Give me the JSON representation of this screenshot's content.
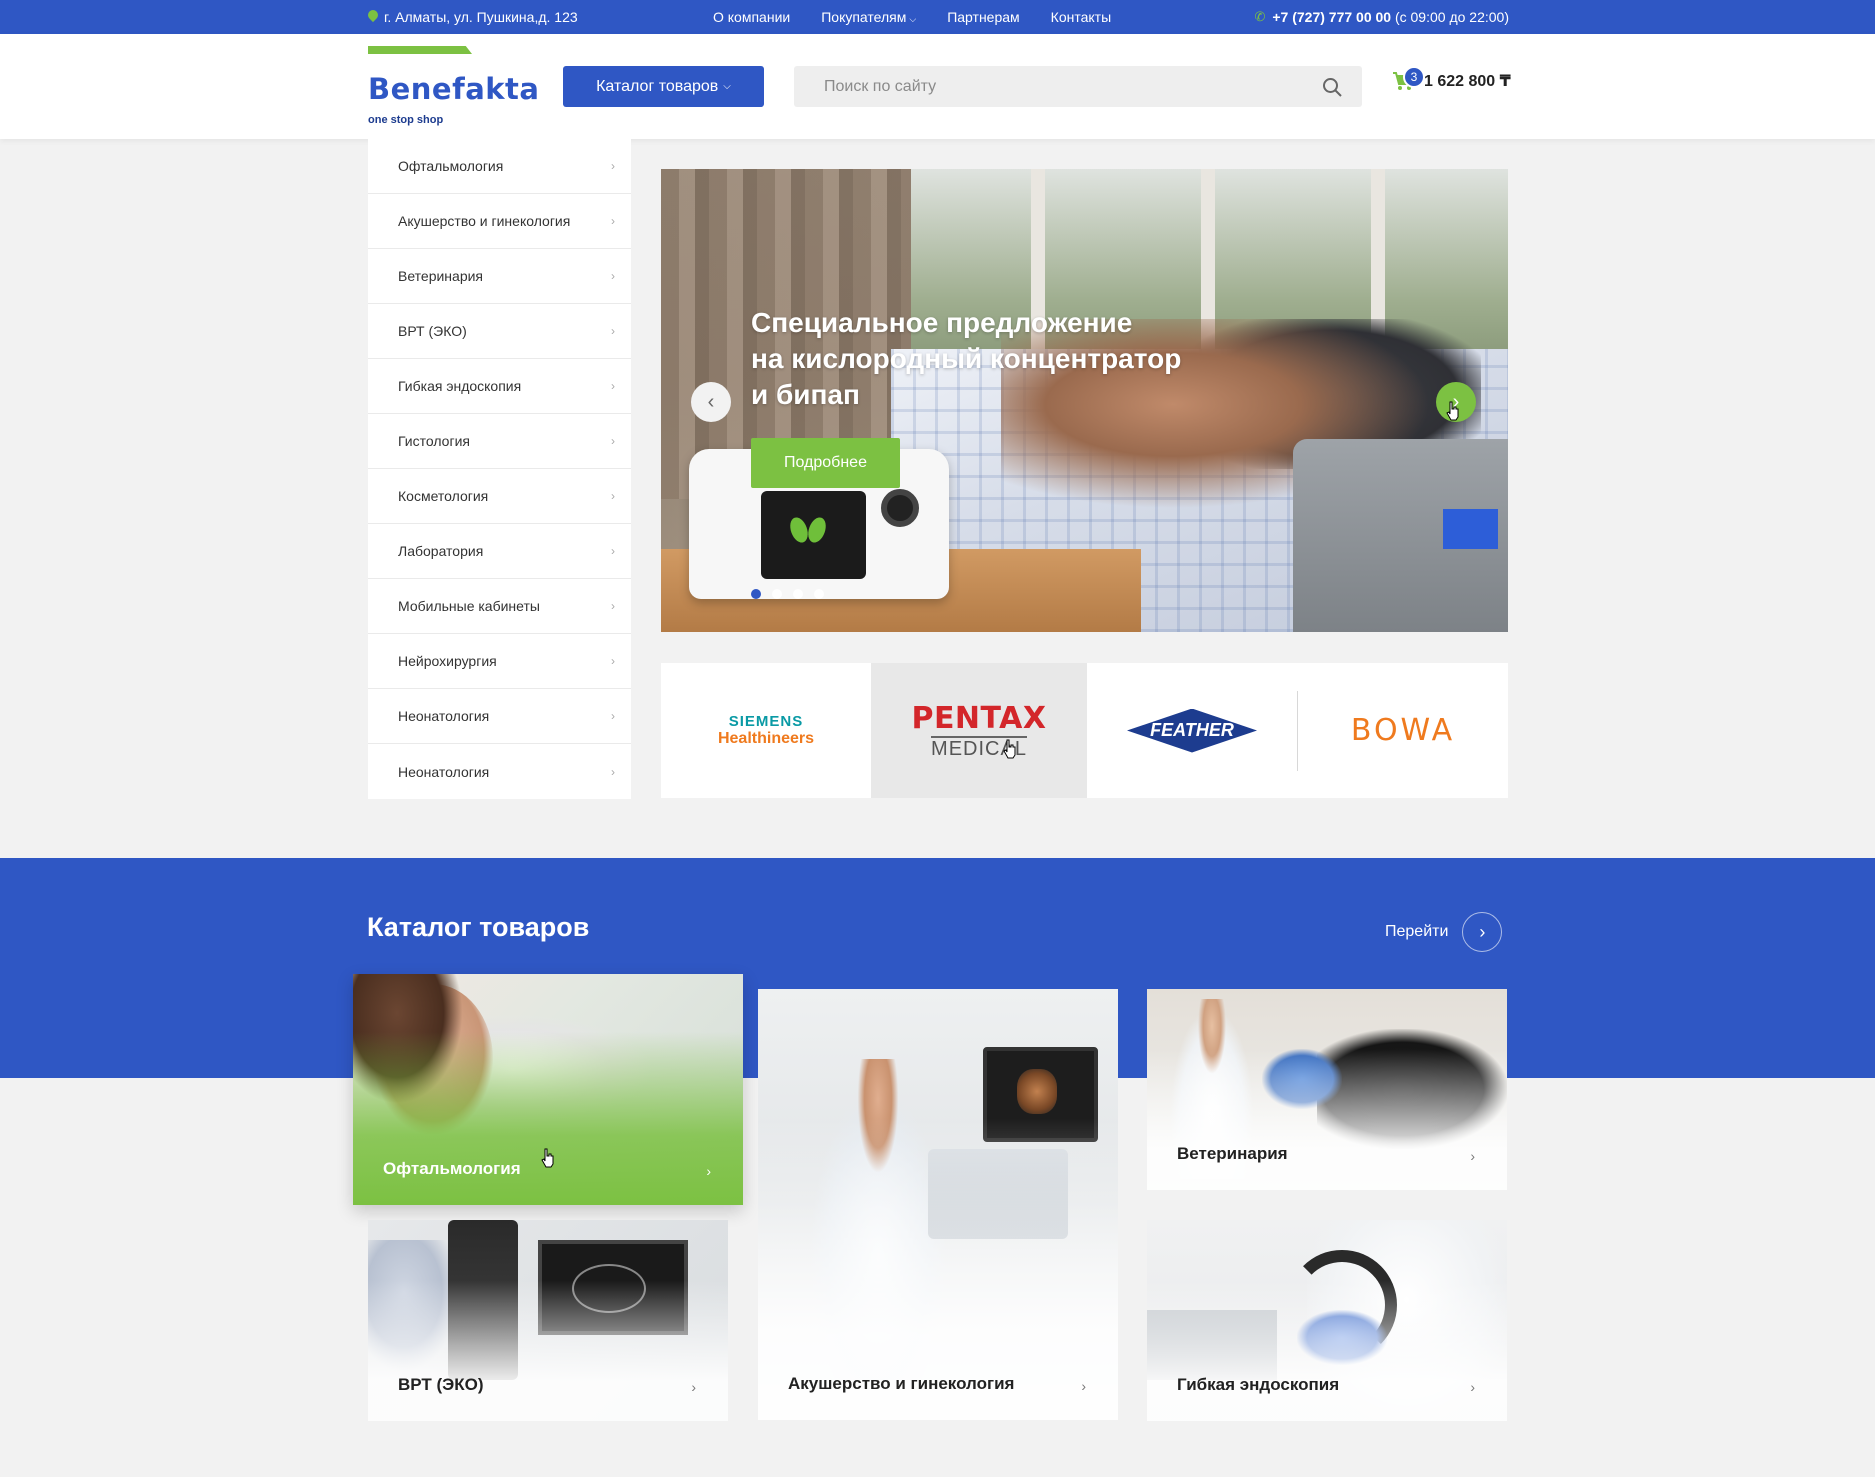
{
  "topbar": {
    "address": "г. Алматы, ул. Пушкина,д. 123",
    "nav": [
      {
        "label": "О компании",
        "has_dropdown": false
      },
      {
        "label": "Покупателям",
        "has_dropdown": true
      },
      {
        "label": "Партнерам",
        "has_dropdown": false
      },
      {
        "label": "Контакты",
        "has_dropdown": false
      }
    ],
    "phone_number": "+7 (727) 777 00 00",
    "phone_hours": "(с 09:00 до 22:00)"
  },
  "header": {
    "logo_name": "Benefakta",
    "logo_tagline": "one stop shop",
    "catalog_button": "Каталог товаров",
    "search_placeholder": "Поиск по сайту",
    "cart_count": "3",
    "cart_total": "1 622 800 ₸"
  },
  "sidebar": {
    "items": [
      "Офтальмология",
      "Акушерство и гинекология",
      "Ветеринария",
      "ВРТ (ЭКО)",
      "Гибкая эндоскопия",
      "Гистология",
      "Косметология",
      "Лаборатория",
      "Мобильные кабинеты",
      "Нейрохирургия",
      "Неонатология",
      "Неонатология"
    ]
  },
  "hero": {
    "title_lines": [
      "Специальное предложение",
      "на кислородный концентратор",
      "и бипап"
    ],
    "button": "Подробнее",
    "slide_count": 4,
    "active_slide": 1
  },
  "brands": {
    "siemens_line1": "SIEMENS",
    "siemens_line2": "Healthineers",
    "pentax_line1": "PENTAX",
    "pentax_line2": "MEDICAL",
    "feather": "FEATHER",
    "bowa": "BOWA"
  },
  "catalog": {
    "title": "Каталог товаров",
    "goto": "Перейти",
    "cards": [
      "Офтальмология",
      "Акушерство и гинекология",
      "Ветеринария",
      "ВРТ (ЭКО)",
      "Гибкая эндоскопия"
    ]
  },
  "colors": {
    "primary_blue": "#2f57c4",
    "accent_green": "#7cc142",
    "bowa_orange": "#ef7a1e",
    "pentax_red": "#d3262a"
  }
}
